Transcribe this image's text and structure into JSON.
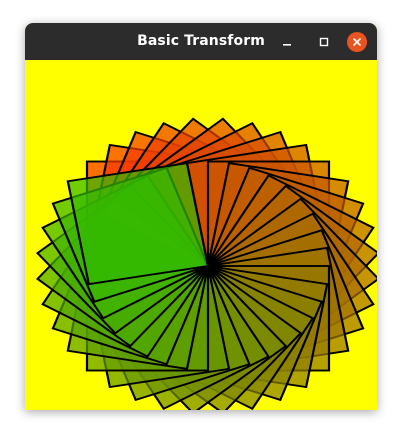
{
  "window": {
    "title": "Basic Transform",
    "controls": {
      "minimize": "minimize-icon",
      "maximize": "maximize-icon",
      "close": "close-icon"
    }
  },
  "colors": {
    "titlebar": "#2c2c2c",
    "canvas_background": "#ffff00",
    "close_button": "#e95420",
    "square_start": "#ff3300",
    "square_end": "#33bb00",
    "stroke": "#000000"
  },
  "graphic": {
    "shape": "square",
    "count": 36,
    "rotation_step_deg": 10,
    "opacity": 0.7
  }
}
